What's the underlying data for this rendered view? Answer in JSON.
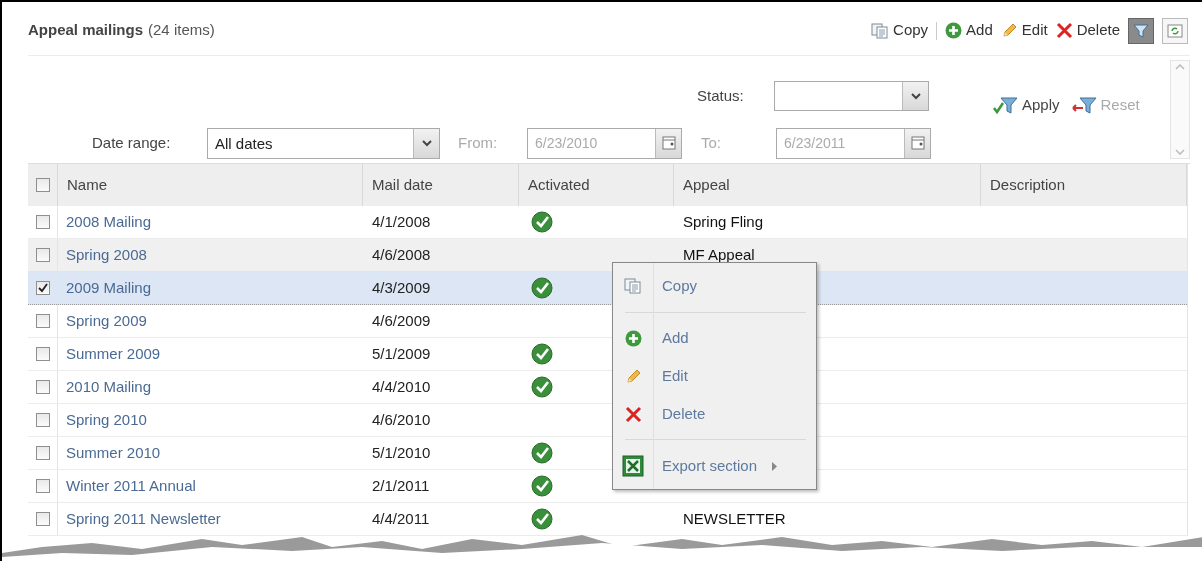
{
  "panel": {
    "title": "Appeal mailings",
    "count": "(24 items)"
  },
  "toolbar": [
    {
      "kind": "copy",
      "label": "Copy"
    },
    {
      "kind": "add",
      "label": "Add"
    },
    {
      "kind": "edit",
      "label": "Edit"
    },
    {
      "kind": "delete",
      "label": "Delete"
    },
    {
      "kind": "filter",
      "pressed": true
    },
    {
      "kind": "refresh",
      "pressed": false
    }
  ],
  "filters": {
    "status": {
      "label": "Status:"
    },
    "date_range": {
      "label": "Date range:",
      "value": "All dates"
    },
    "from": {
      "label": "From:",
      "value": "6/23/2010",
      "disabled": true
    },
    "to": {
      "label": "To:",
      "value": "6/23/2011",
      "disabled": true
    },
    "apply": {
      "label": "Apply",
      "disabled": false
    },
    "reset": {
      "label": "Reset",
      "disabled": true
    }
  },
  "table": {
    "select_all_checked": false,
    "columns": [
      "Name",
      "Mail date",
      "Activated",
      "Appeal",
      "Description"
    ],
    "rows": [
      {
        "name": "2008 Mailing",
        "mail_date": "4/1/2008",
        "activated": true,
        "appeal": "Spring Fling",
        "checked": false,
        "selected": false,
        "hovered": false
      },
      {
        "name": "Spring 2008",
        "mail_date": "4/6/2008",
        "activated": false,
        "appeal": "MF Appeal",
        "checked": false,
        "selected": false,
        "hovered": true
      },
      {
        "name": "2009 Mailing",
        "mail_date": "4/3/2009",
        "activated": true,
        "checked": true,
        "selected": true,
        "hovered": false
      },
      {
        "name": "Spring 2009",
        "mail_date": "4/6/2009",
        "activated": false,
        "checked": false,
        "selected": false,
        "hovered": false
      },
      {
        "name": "Summer 2009",
        "mail_date": "5/1/2009",
        "activated": true,
        "checked": false,
        "selected": false,
        "hovered": false
      },
      {
        "name": "2010 Mailing",
        "mail_date": "4/4/2010",
        "activated": true,
        "checked": false,
        "selected": false,
        "hovered": false
      },
      {
        "name": "Spring 2010",
        "mail_date": "4/6/2010",
        "activated": false,
        "checked": false,
        "selected": false,
        "hovered": false
      },
      {
        "name": "Summer 2010",
        "mail_date": "5/1/2010",
        "activated": true,
        "checked": false,
        "selected": false,
        "hovered": false
      },
      {
        "name": "Winter 2011 Annual",
        "mail_date": "2/1/2011",
        "activated": true,
        "checked": false,
        "selected": false,
        "hovered": false
      },
      {
        "name": "Spring 2011 Newsletter",
        "mail_date": "4/4/2011",
        "activated": true,
        "appeal": "NEWSLETTER",
        "checked": false,
        "selected": false,
        "hovered": false
      }
    ]
  },
  "context_menu": [
    {
      "kind": "copy",
      "label": "Copy"
    },
    {
      "kind": "separator"
    },
    {
      "kind": "add",
      "label": "Add"
    },
    {
      "kind": "edit",
      "label": "Edit"
    },
    {
      "kind": "delete",
      "label": "Delete"
    },
    {
      "kind": "separator"
    },
    {
      "kind": "export",
      "label": "Export section",
      "submenu": true
    }
  ]
}
